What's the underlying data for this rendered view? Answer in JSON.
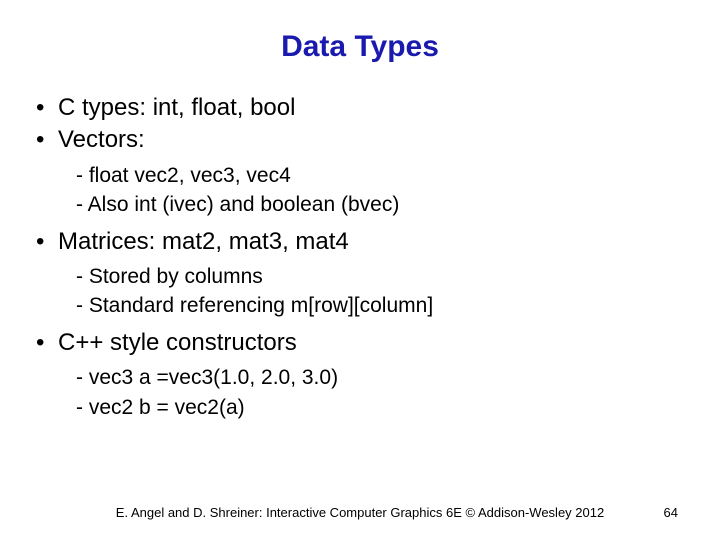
{
  "title": "Data Types",
  "bullets": {
    "b1": "C types: int, float, bool",
    "b2": "Vectors:",
    "b2_sub": {
      "s1": "- float vec2, vec3, vec4",
      "s2": "- Also int (ivec) and boolean (bvec)"
    },
    "b3": "Matrices: mat2, mat3, mat4",
    "b3_sub": {
      "s1": "- Stored by columns",
      "s2": "- Standard referencing m[row][column]"
    },
    "b4": "C++ style constructors",
    "b4_sub": {
      "s1": "- vec3 a =vec3(1.0, 2.0, 3.0)",
      "s2": "- vec2 b = vec2(a)"
    }
  },
  "footer": "E. Angel and D. Shreiner: Interactive Computer Graphics 6E © Addison-Wesley 2012",
  "page_number": "64"
}
